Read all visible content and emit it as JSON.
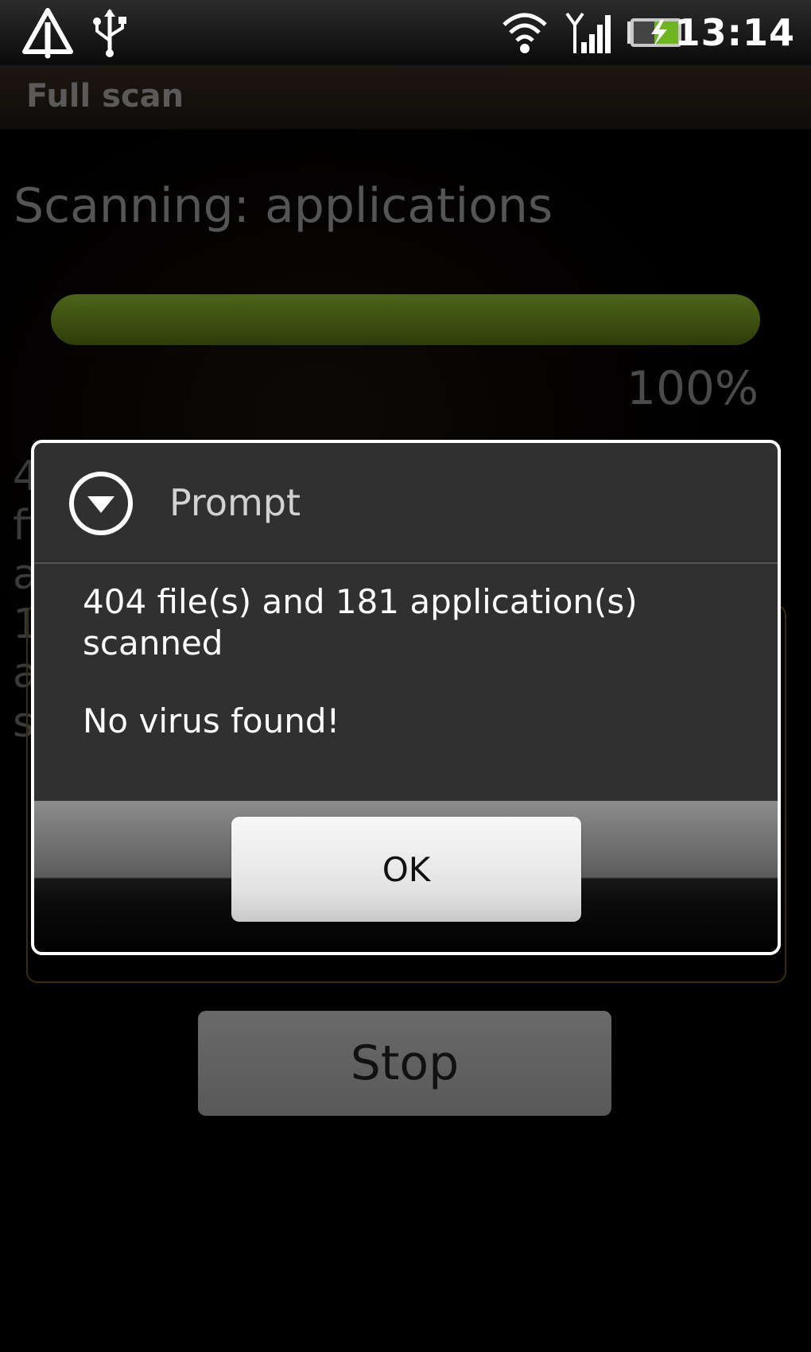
{
  "status_bar": {
    "time": "13:14",
    "icons": [
      "warning-icon",
      "usb-icon",
      "wifi-icon",
      "signal-icon",
      "battery-charging-icon"
    ]
  },
  "title_bar": {
    "title": "Full scan"
  },
  "scan": {
    "status": "Scanning: applications",
    "progress": 1.0,
    "progress_label": "100%",
    "progress_color": "#3c4f10",
    "stop_label": "Stop"
  },
  "dialog": {
    "icon": "dropdown-circle-icon",
    "title": "Prompt",
    "message": "404 file(s) and 181 application(s) scanned",
    "result": "No virus found!",
    "ok_label": "OK"
  }
}
